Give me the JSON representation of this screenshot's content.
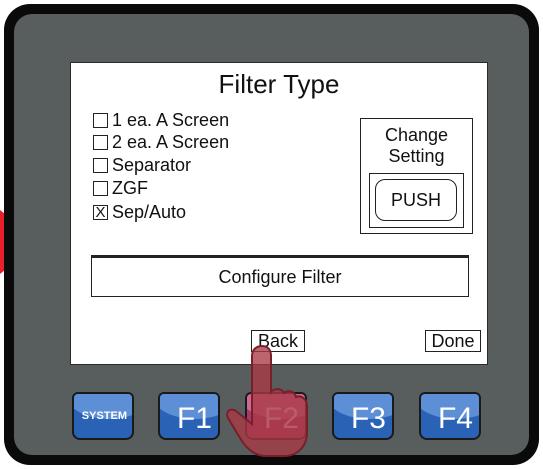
{
  "screen": {
    "title": "Filter Type",
    "options": [
      {
        "label": "1 ea. A Screen",
        "mark": ""
      },
      {
        "label": "2 ea. A Screen",
        "mark": ""
      },
      {
        "label": "Separator",
        "mark": ""
      },
      {
        "label": "ZGF",
        "mark": ""
      },
      {
        "label": "Sep/Auto",
        "mark": "X"
      }
    ],
    "change_setting": {
      "line1": "Change",
      "line2": "Setting",
      "push_label": "PUSH"
    },
    "configure_label": "Configure Filter",
    "back_label": "Back",
    "done_label": "Done"
  },
  "function_keys": [
    {
      "label": "SYSTEM",
      "active": false
    },
    {
      "label": "F1",
      "active": false
    },
    {
      "label": "F2",
      "active": true
    },
    {
      "label": "F3",
      "active": false
    },
    {
      "label": "F4",
      "active": false
    }
  ],
  "colors": {
    "arrow": "#e8202a",
    "key_blue": "#2a63b5",
    "key_active": "#a9376b",
    "bezel": "#0a0a0a",
    "panel": "#585e5e"
  },
  "icons": {
    "pointer": "hand-pointer-icon",
    "indicator": "red-arrow-icon"
  }
}
